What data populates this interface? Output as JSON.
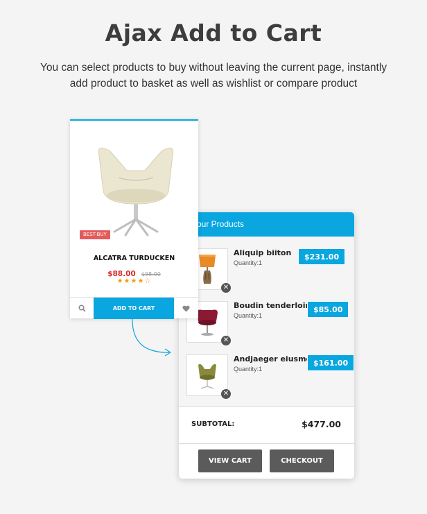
{
  "hero": {
    "title": "Ajax Add to Cart",
    "subtitle_line1": "You can select products to buy without leaving the current page, instantly",
    "subtitle_line2": "add product to basket as well as wishlist or compare product"
  },
  "product": {
    "badge": "BEST-BUY",
    "name": "ALCATRA TURDUCKEN",
    "price": "$88.00",
    "old_price": "$98.00",
    "rating": 4.5,
    "stars_text": "★★★★☆",
    "add_to_cart_label": "ADD TO CART",
    "icons": [
      "search-icon",
      "heart-icon"
    ]
  },
  "cart": {
    "header": "our Products",
    "items": [
      {
        "name": "Aliquip biiton",
        "quantity": "Quantity:1",
        "price": "$231.00",
        "thumb": "lamp"
      },
      {
        "name": "Boudin tenderloin",
        "quantity": "Quantity:1",
        "price": "$85.00",
        "thumb": "red-chair"
      },
      {
        "name": "Andjaeger eiusmo",
        "quantity": "Quantity:1",
        "price": "$161.00",
        "thumb": "olive-chair"
      }
    ],
    "subtotal_label": "SUBTOTAL:",
    "subtotal_value": "$477.00",
    "view_cart_label": "VIEW CART",
    "checkout_label": "CHECKOUT"
  },
  "colors": {
    "accent": "#09a6e0",
    "price_red": "#d62d2d",
    "star": "#f39c12",
    "button_dark": "#5b5b5b",
    "badge": "#e45a5a"
  }
}
